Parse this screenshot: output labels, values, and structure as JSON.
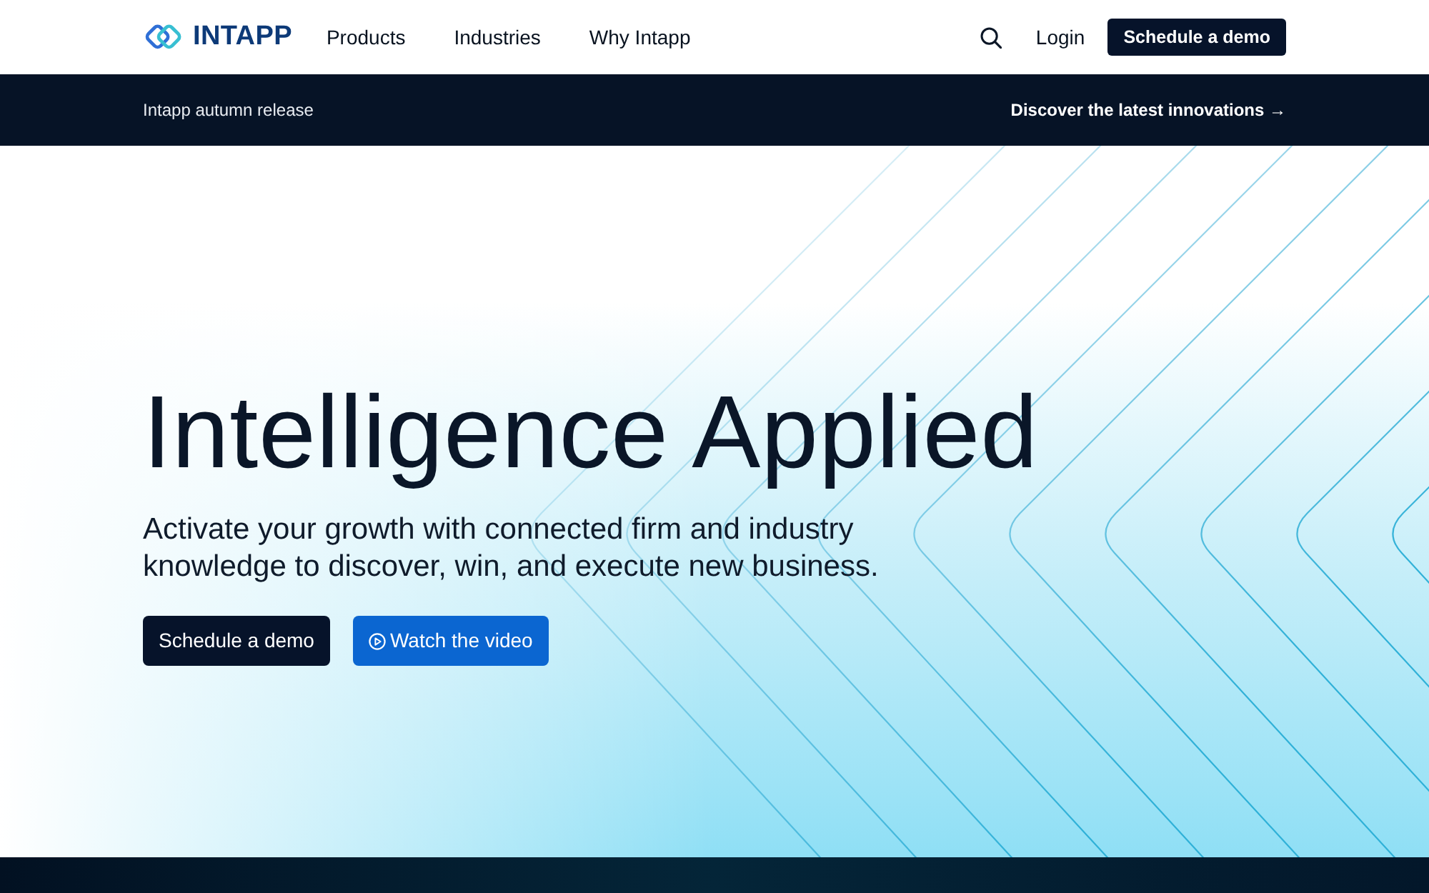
{
  "nav": {
    "logo": "INTAPP",
    "links": [
      "Products",
      "Industries",
      "Why Intapp"
    ],
    "login": "Login",
    "cta": "Schedule a demo"
  },
  "banner": {
    "text": "Intapp autumn release",
    "link": "Discover the latest innovations →"
  },
  "hero": {
    "title": "Intelligence Applied",
    "subtitle": "Activate your growth with connected firm and industry knowledge to discover, win, and execute new business.",
    "buttons": [
      {
        "label": "Schedule a demo",
        "kind": "primary"
      },
      {
        "label": "Watch the video",
        "kind": "video"
      }
    ]
  }
}
